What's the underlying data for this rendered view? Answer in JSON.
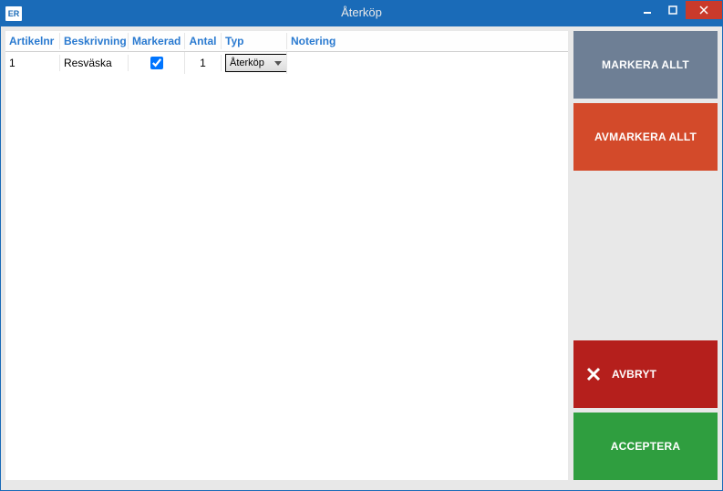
{
  "window": {
    "app_icon_text": "ER",
    "title": "Återköp"
  },
  "grid": {
    "headers": {
      "artikelnr": "Artikelnr",
      "beskrivning": "Beskrivning",
      "markerad": "Markerad",
      "antal": "Antal",
      "typ": "Typ",
      "notering": "Notering"
    },
    "row0": {
      "artikelnr": "1",
      "beskrivning": "Resväska",
      "markerad": true,
      "antal": "1",
      "typ": "Återköp",
      "notering": ""
    }
  },
  "sidebar": {
    "markera_allt": "MARKERA ALLT",
    "avmarkera_allt": "AVMARKERA ALLT",
    "avbryt": "AVBRYT",
    "acceptera": "ACCEPTERA"
  }
}
